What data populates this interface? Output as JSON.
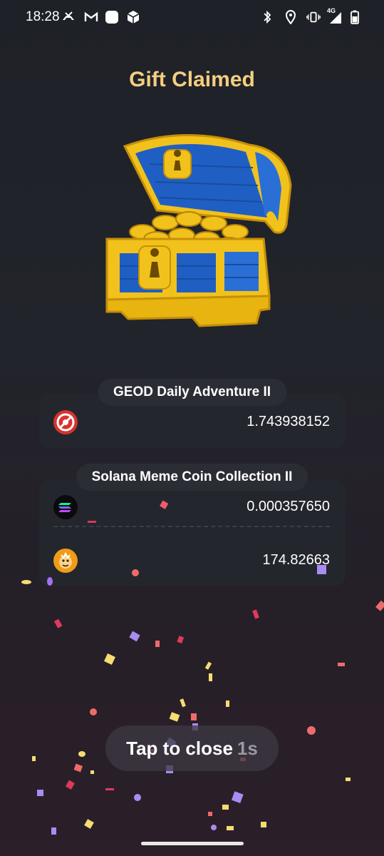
{
  "status_bar": {
    "time": "18:28",
    "network": "4G"
  },
  "title": "Gift Claimed",
  "cards": [
    {
      "title": "GEOD Daily Adventure II",
      "rows": [
        {
          "icon": "geod-token-icon",
          "amount": "1.743938152"
        }
      ]
    },
    {
      "title": "Solana Meme Coin Collection II",
      "rows": [
        {
          "icon": "solana-token-icon",
          "amount": "0.000357650"
        },
        {
          "icon": "meme-token-icon",
          "amount": "174.82663"
        }
      ]
    }
  ],
  "close": {
    "label": "Tap to close",
    "countdown": "1s"
  },
  "colors": {
    "title": "#f3cf7f",
    "card_bg": "#24262d",
    "chest_gold": "#f2c21c",
    "chest_blue": "#1f5fc4"
  }
}
